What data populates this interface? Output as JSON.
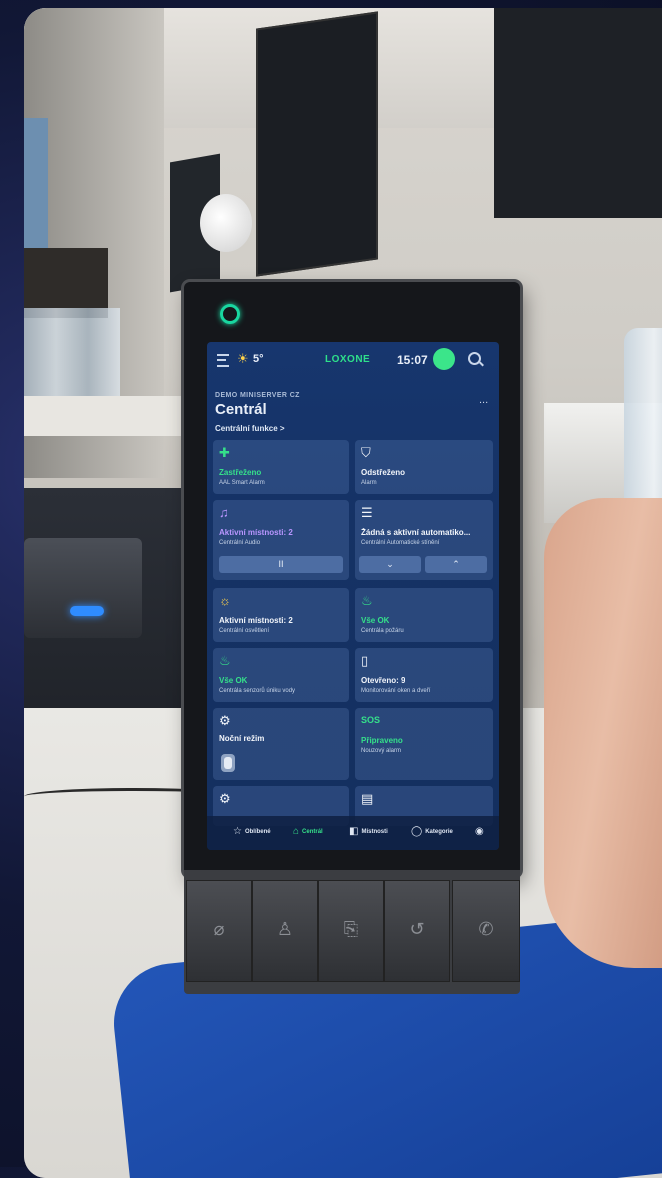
{
  "device": {
    "topbar": {
      "temperature": "5°",
      "logo": "LOXONE",
      "time": "15:07",
      "weather_icon": "sun-cloud-icon",
      "more": "..."
    },
    "header": {
      "subtitle": "DEMO MINISERVER CZ",
      "title": "Centrál",
      "breadcrumb": "Centrální funkce",
      "breadcrumb_arrow": ">"
    },
    "tiles": [
      {
        "title": "Zastřeženo",
        "subtitle": "AAL Smart Alarm",
        "icon": "plus-icon",
        "glyph": "✚"
      },
      {
        "title": "Odstřeženo",
        "subtitle": "Alarm",
        "icon": "shield-icon",
        "glyph": "⛉"
      },
      {
        "title": "Aktivní místnosti: 2",
        "subtitle": "Centrální Audio",
        "icon": "music-note-icon",
        "glyph": "♫",
        "control": "II"
      },
      {
        "title": "Žádná s aktivní automatiko...",
        "subtitle": "Centrální Automatické stínění",
        "icon": "blinds-icon",
        "glyph": "☰",
        "control_down": "⌄",
        "control_up": "⌃"
      },
      {
        "title": "Aktivní místnosti: 2",
        "subtitle": "Centrální osvětlení",
        "icon": "bulb-icon",
        "glyph": "☼"
      },
      {
        "title": "Vše OK",
        "subtitle": "Centrála požáru",
        "icon": "fire-sensor-icon",
        "glyph": "♨"
      },
      {
        "title": "Vše OK",
        "subtitle": "Centrála senzorů úniku vody",
        "icon": "water-sensor-icon",
        "glyph": "♨"
      },
      {
        "title": "Otevřeno: 9",
        "subtitle": "Monitorování oken a dveří",
        "icon": "window-icon",
        "glyph": "▯"
      },
      {
        "title": "Noční režim",
        "subtitle": "",
        "icon": "gear-icon",
        "glyph": "⚙"
      },
      {
        "title": "Připraveno",
        "subtitle": "Nouzový alarm",
        "icon": "sos-icon",
        "glyph": "SOS"
      },
      {
        "title": "",
        "subtitle": "",
        "icon": "gear-icon",
        "glyph": "⚙"
      },
      {
        "title": "",
        "subtitle": "",
        "icon": "document-icon",
        "glyph": "▤"
      }
    ],
    "tabs": [
      {
        "label": "Oblíbené",
        "icon": "star-icon",
        "glyph": "☆"
      },
      {
        "label": "Centrál",
        "icon": "home-icon",
        "glyph": "⌂"
      },
      {
        "label": "Místnosti",
        "icon": "room-icon",
        "glyph": "◧"
      },
      {
        "label": "Kategorie",
        "icon": "category-icon",
        "glyph": "◯"
      },
      {
        "label": "",
        "icon": "location-icon",
        "glyph": "◉"
      }
    ],
    "colors": {
      "accent": "#35e08a",
      "screen_bg": "#153265",
      "tile_bg": "#3a5a8f"
    }
  }
}
